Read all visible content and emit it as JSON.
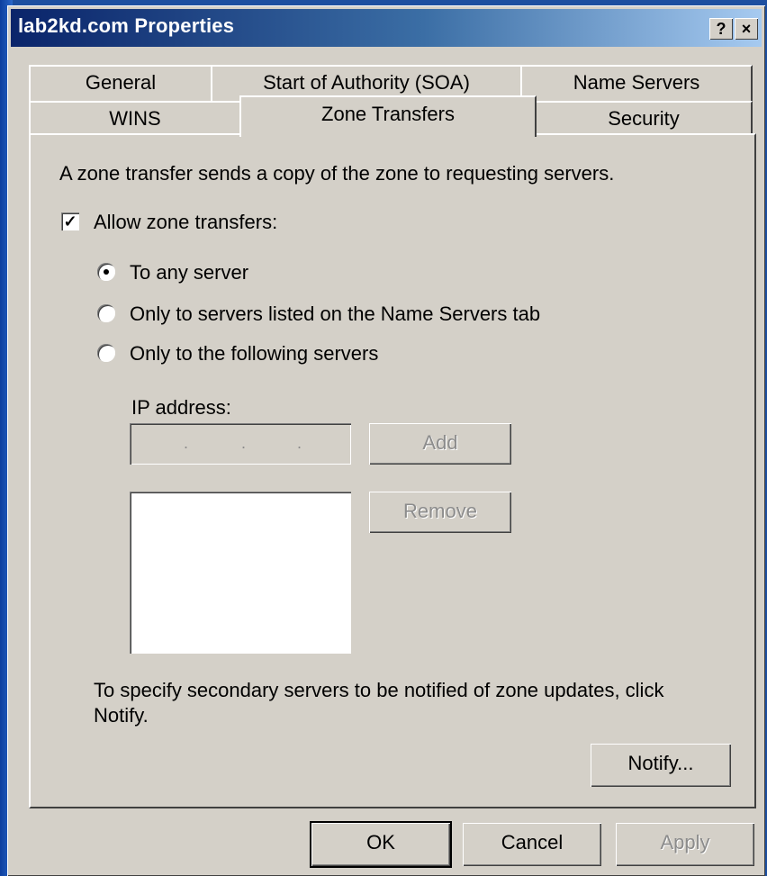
{
  "window": {
    "title": "lab2kd.com Properties",
    "help_glyph": "?",
    "close_glyph": "×"
  },
  "tabs": {
    "row1": [
      "General",
      "Start of Authority (SOA)",
      "Name Servers"
    ],
    "row2": [
      "WINS",
      "Zone Transfers",
      "Security"
    ],
    "active": "Zone Transfers"
  },
  "panel": {
    "description": "A zone transfer sends a copy of the zone to requesting servers.",
    "allow_label": "Allow zone transfers:",
    "allow_checked": true,
    "radio_options": [
      "To any server",
      "Only to servers listed on the Name Servers tab",
      "Only to the following servers"
    ],
    "selected_radio": "To any server",
    "ip_label": "IP address:",
    "ip_placeholder_dots": ".",
    "add_label": "Add",
    "remove_label": "Remove",
    "notify_text_line1": "To specify secondary servers to be notified of zone updates, click",
    "notify_text_line2": "Notify.",
    "notify_label": "Notify..."
  },
  "footer": {
    "ok_label": "OK",
    "cancel_label": "Cancel",
    "apply_label": "Apply"
  },
  "colors": {
    "face": "#d4d0c8",
    "title_start": "#0a246a",
    "title_end": "#a6caf0",
    "desktop": "#1d4fa0"
  },
  "icons": {
    "check": "check-mark-icon",
    "help": "help-icon",
    "close": "close-icon"
  }
}
